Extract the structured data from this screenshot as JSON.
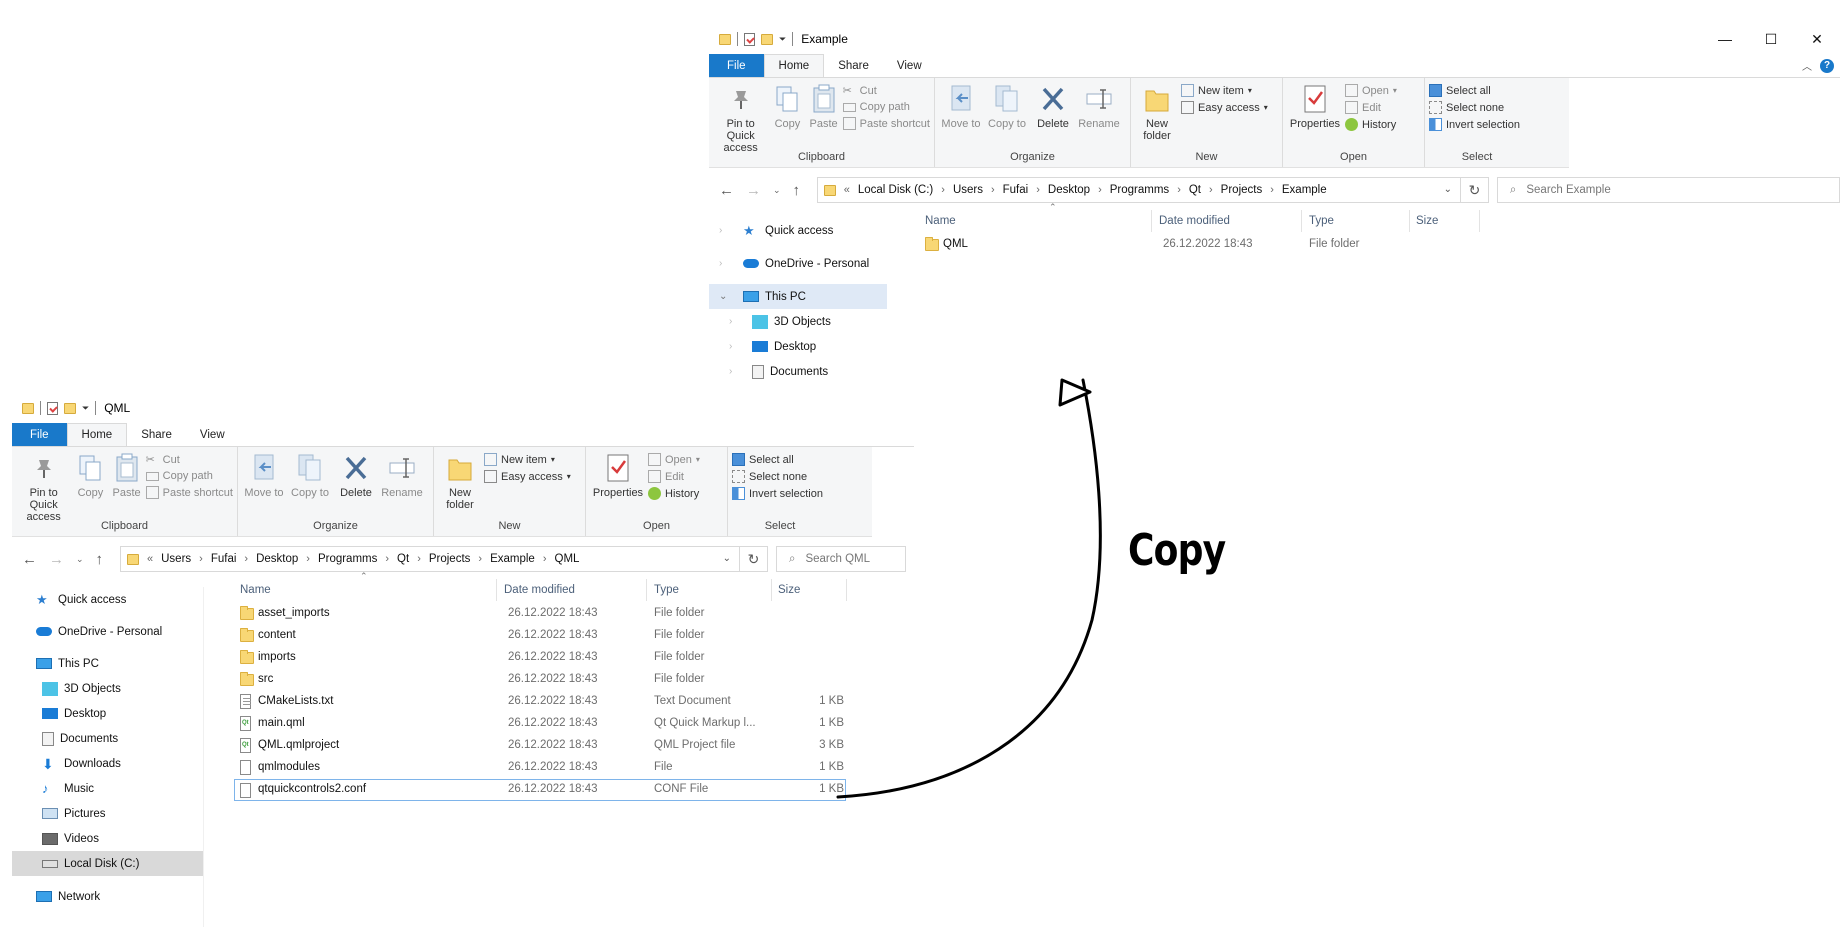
{
  "ribbon": {
    "tabs": [
      "File",
      "Home",
      "Share",
      "View"
    ],
    "clipboard": {
      "pin": "Pin to Quick access",
      "copy": "Copy",
      "paste": "Paste",
      "cut": "Cut",
      "copy_path": "Copy path",
      "paste_shortcut": "Paste shortcut",
      "label": "Clipboard"
    },
    "organize": {
      "move_to": "Move to",
      "copy_to": "Copy to",
      "delete": "Delete",
      "rename": "Rename",
      "label": "Organize"
    },
    "new": {
      "new_folder": "New folder",
      "new_item": "New item",
      "easy_access": "Easy access",
      "label": "New"
    },
    "open": {
      "properties": "Properties",
      "open": "Open",
      "edit": "Edit",
      "history": "History",
      "label": "Open"
    },
    "select": {
      "select_all": "Select all",
      "select_none": "Select none",
      "invert": "Invert selection",
      "label": "Select"
    }
  },
  "top_window": {
    "title": "Example",
    "breadcrumb": [
      "Local Disk (C:)",
      "Users",
      "Fufai",
      "Desktop",
      "Programms",
      "Qt",
      "Projects",
      "Example"
    ],
    "search_placeholder": "Search Example",
    "nav": [
      "Quick access",
      "OneDrive - Personal",
      "This PC",
      "3D Objects",
      "Desktop",
      "Documents"
    ],
    "columns": [
      "Name",
      "Date modified",
      "Type",
      "Size"
    ],
    "files": [
      {
        "name": "QML",
        "date": "26.12.2022 18:43",
        "type": "File folder",
        "size": ""
      }
    ]
  },
  "bottom_window": {
    "title": "QML",
    "breadcrumb": [
      "Users",
      "Fufai",
      "Desktop",
      "Programms",
      "Qt",
      "Projects",
      "Example",
      "QML"
    ],
    "search_placeholder": "Search QML",
    "nav": [
      "Quick access",
      "OneDrive - Personal",
      "This PC",
      "3D Objects",
      "Desktop",
      "Documents",
      "Downloads",
      "Music",
      "Pictures",
      "Videos",
      "Local Disk (C:)",
      "Network"
    ],
    "columns": [
      "Name",
      "Date modified",
      "Type",
      "Size"
    ],
    "files": [
      {
        "name": "asset_imports",
        "date": "26.12.2022 18:43",
        "type": "File folder",
        "size": ""
      },
      {
        "name": "content",
        "date": "26.12.2022 18:43",
        "type": "File folder",
        "size": ""
      },
      {
        "name": "imports",
        "date": "26.12.2022 18:43",
        "type": "File folder",
        "size": ""
      },
      {
        "name": "src",
        "date": "26.12.2022 18:43",
        "type": "File folder",
        "size": ""
      },
      {
        "name": "CMakeLists.txt",
        "date": "26.12.2022 18:43",
        "type": "Text Document",
        "size": "1 KB"
      },
      {
        "name": "main.qml",
        "date": "26.12.2022 18:43",
        "type": "Qt Quick Markup l...",
        "size": "1 KB"
      },
      {
        "name": "QML.qmlproject",
        "date": "26.12.2022 18:43",
        "type": "QML Project file",
        "size": "3 KB"
      },
      {
        "name": "qmlmodules",
        "date": "26.12.2022 18:43",
        "type": "File",
        "size": "1 KB"
      },
      {
        "name": "qtquickcontrols2.conf",
        "date": "26.12.2022 18:43",
        "type": "CONF File",
        "size": "1 KB"
      }
    ]
  },
  "annotation": {
    "label": "Copy"
  }
}
